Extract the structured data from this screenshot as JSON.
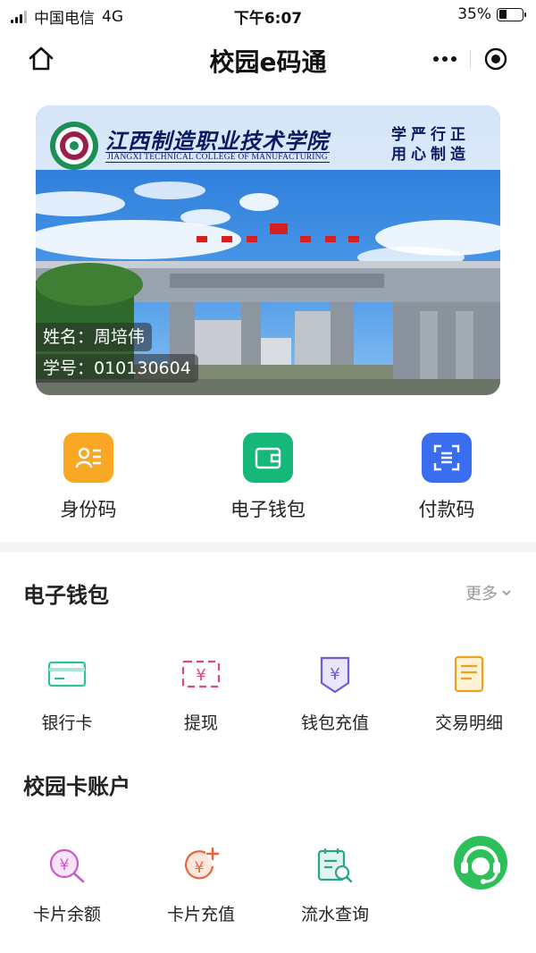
{
  "status_bar": {
    "carrier": "中国电信",
    "network": "4G",
    "time": "下午6:07",
    "battery_percent": "35%",
    "battery_level": 0.35
  },
  "nav": {
    "title": "校园e码通"
  },
  "card": {
    "college_name_zh": "江西制造职业技术学院",
    "college_name_en": "JIANGXI TECHNICAL COLLEGE OF MANUFACTURING",
    "motto": "学严行正用心制造",
    "name": "姓名：周培伟",
    "student_id": "学号：010130604"
  },
  "quick_actions": [
    {
      "label": "身份码",
      "icon": "id-card-icon",
      "color": "#f9a825"
    },
    {
      "label": "电子钱包",
      "icon": "wallet-icon",
      "color": "#16b87a"
    },
    {
      "label": "付款码",
      "icon": "scan-icon",
      "color": "#3a6df0"
    }
  ],
  "wallet_section": {
    "title": "电子钱包",
    "more": "更多",
    "items": [
      {
        "label": "银行卡",
        "icon": "bank-card-icon"
      },
      {
        "label": "提现",
        "icon": "withdraw-icon"
      },
      {
        "label": "钱包充值",
        "icon": "wallet-recharge-icon"
      },
      {
        "label": "交易明细",
        "icon": "transaction-detail-icon"
      }
    ]
  },
  "campus_account_section": {
    "title": "校园卡账户",
    "items": [
      {
        "label": "卡片余额",
        "icon": "balance-icon"
      },
      {
        "label": "卡片充值",
        "icon": "card-recharge-icon"
      },
      {
        "label": "流水查询",
        "icon": "records-search-icon"
      },
      {
        "label": "",
        "icon": "customer-service-icon"
      }
    ]
  }
}
